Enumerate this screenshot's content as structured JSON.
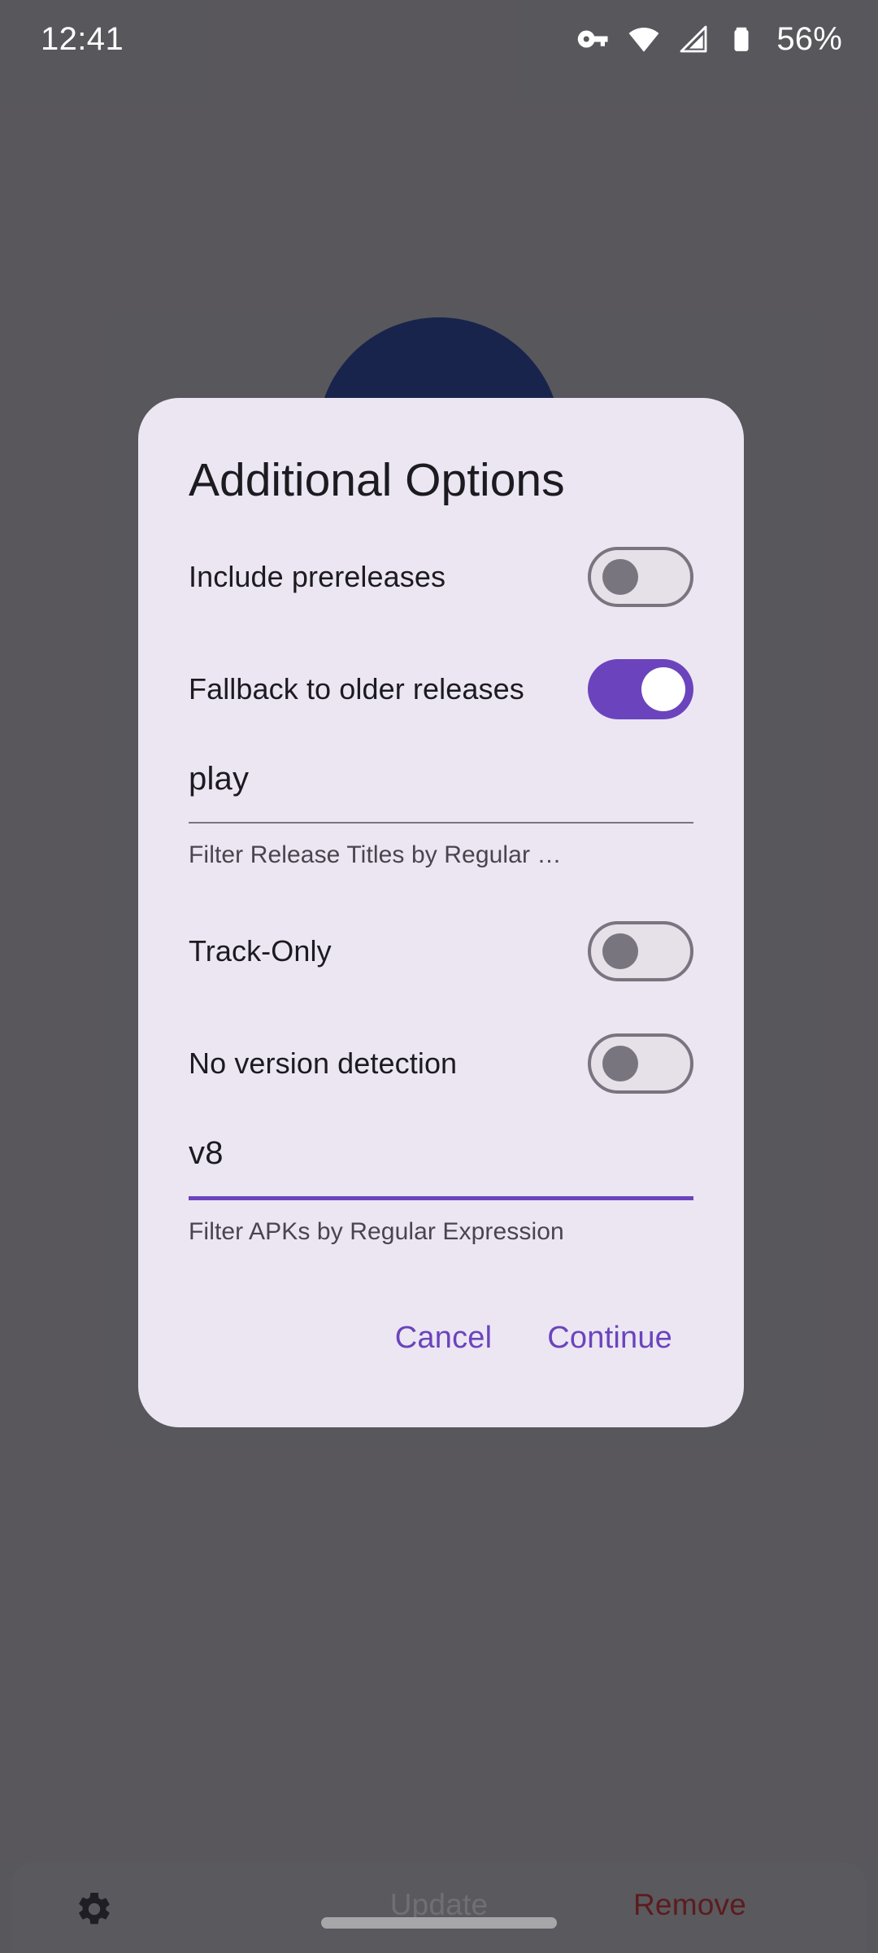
{
  "status_bar": {
    "time": "12:41",
    "battery_percent": "56%",
    "icons": [
      "vpn-key-icon",
      "wifi-icon",
      "cellular-signal-icon",
      "battery-icon"
    ]
  },
  "dialog": {
    "title": "Additional Options",
    "switches": [
      {
        "label": "Include prereleases",
        "state": "off"
      },
      {
        "label": "Fallback to older releases",
        "state": "on"
      },
      {
        "label": "Track-Only",
        "state": "off"
      },
      {
        "label": "No version detection",
        "state": "off"
      }
    ],
    "fields": [
      {
        "value": "play",
        "placeholder": "Filter Release Titles by Regular Expression",
        "helper": "Filter Release Titles by Regular …",
        "focused": false
      },
      {
        "value": "v8",
        "placeholder": "Filter APKs by Regular Expression",
        "helper": "Filter APKs by Regular Expression",
        "focused": true
      }
    ],
    "actions": {
      "cancel_label": "Cancel",
      "continue_label": "Continue"
    }
  },
  "bottom_bar": {
    "settings_icon": "gear-icon",
    "update_label": "Update",
    "remove_label": "Remove"
  },
  "colors": {
    "accent_purple": "#6b44bd",
    "dialog_surface": "#ece6f3",
    "remove_red": "#7b2221",
    "app_icon_navy": "#1d2d63",
    "switch_off_outline": "#79757f"
  }
}
